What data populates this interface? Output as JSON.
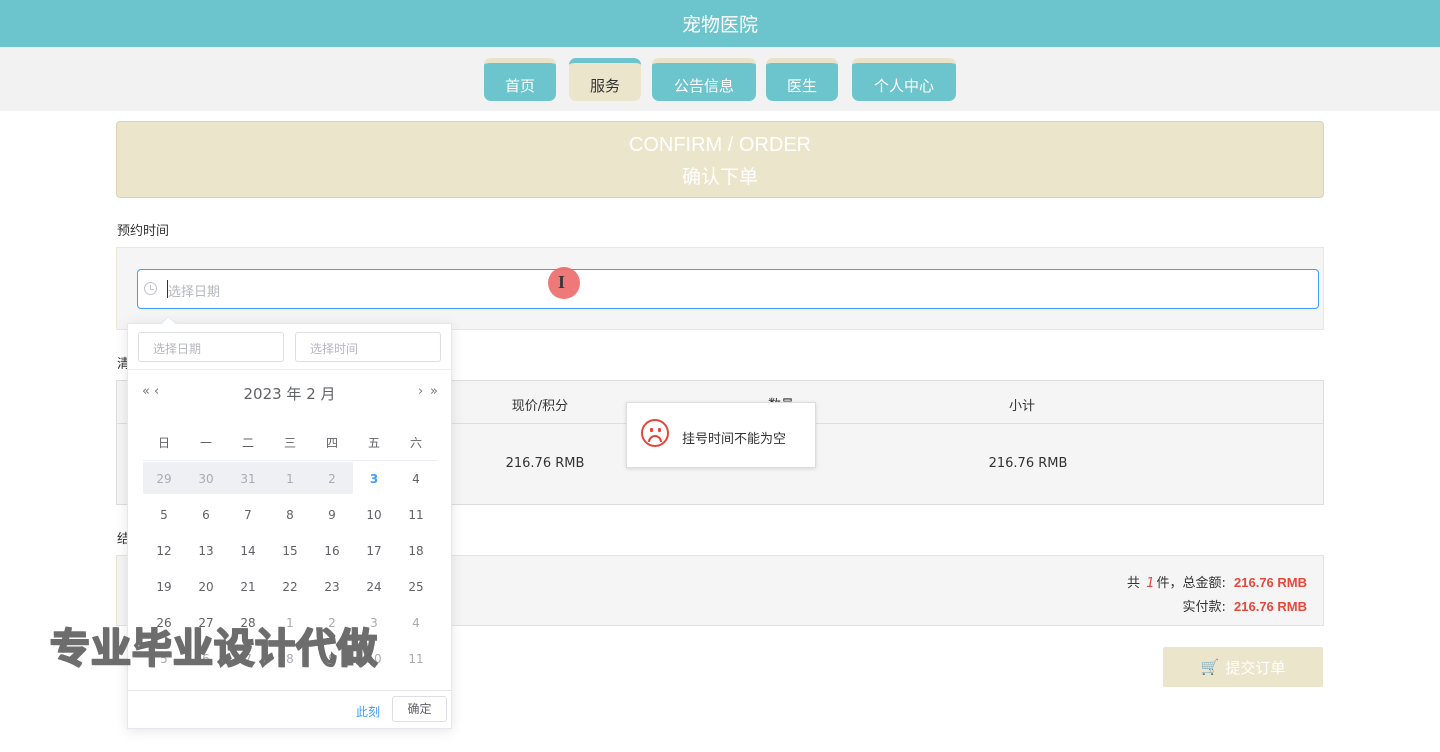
{
  "app": {
    "title": "宠物医院"
  },
  "nav": {
    "tabs": [
      {
        "label": "首页",
        "active": false
      },
      {
        "label": "服务",
        "active": true
      },
      {
        "label": "公告信息",
        "active": false
      },
      {
        "label": "医生",
        "active": false
      },
      {
        "label": "个人中心",
        "active": false
      }
    ]
  },
  "banner": {
    "title_en": "CONFIRM / ORDER",
    "title_cn": "确认下单"
  },
  "appointment": {
    "label": "预约时间",
    "input_placeholder": "选择日期"
  },
  "list_label_partial": "清",
  "settle_label_partial": "结",
  "table": {
    "headers": {
      "price": "现价/积分",
      "quantity": "数量",
      "subtotal": "小计"
    },
    "row": {
      "price": "216.76 RMB",
      "subtotal": "216.76 RMB"
    }
  },
  "toast": {
    "message": "挂号时间不能为空"
  },
  "summary": {
    "line1_prefix": "共",
    "count": "1",
    "line1_mid": "件，总金额:",
    "total": "216.76 RMB",
    "line2_label": "实付款:",
    "paid": "216.76 RMB"
  },
  "submit": {
    "label": "提交订单",
    "icon": "cart-icon"
  },
  "datepicker": {
    "date_placeholder": "选择日期",
    "time_placeholder": "选择时间",
    "year_month": "2023 年  2 月",
    "prev_year": "«",
    "prev_month": "‹",
    "next_month": "›",
    "next_year": "»",
    "weekdays": [
      "日",
      "一",
      "二",
      "三",
      "四",
      "五",
      "六"
    ],
    "weeks": [
      [
        "29",
        "30",
        "31",
        "1",
        "2",
        "3",
        "4"
      ],
      [
        "5",
        "6",
        "7",
        "8",
        "9",
        "10",
        "11"
      ],
      [
        "12",
        "13",
        "14",
        "15",
        "16",
        "17",
        "18"
      ],
      [
        "19",
        "20",
        "21",
        "22",
        "23",
        "24",
        "25"
      ],
      [
        "26",
        "27",
        "28",
        "1",
        "2",
        "3",
        "4"
      ],
      [
        "5",
        "6",
        "7",
        "8",
        "9",
        "10",
        "11"
      ]
    ],
    "today": "3",
    "now_label": "此刻",
    "confirm_label": "确定"
  },
  "watermark": "专业毕业设计代做",
  "colors": {
    "teal": "#6cc4cc",
    "beige": "#ebe5cb",
    "accent_red": "#e5483a",
    "link_blue": "#409eff"
  }
}
